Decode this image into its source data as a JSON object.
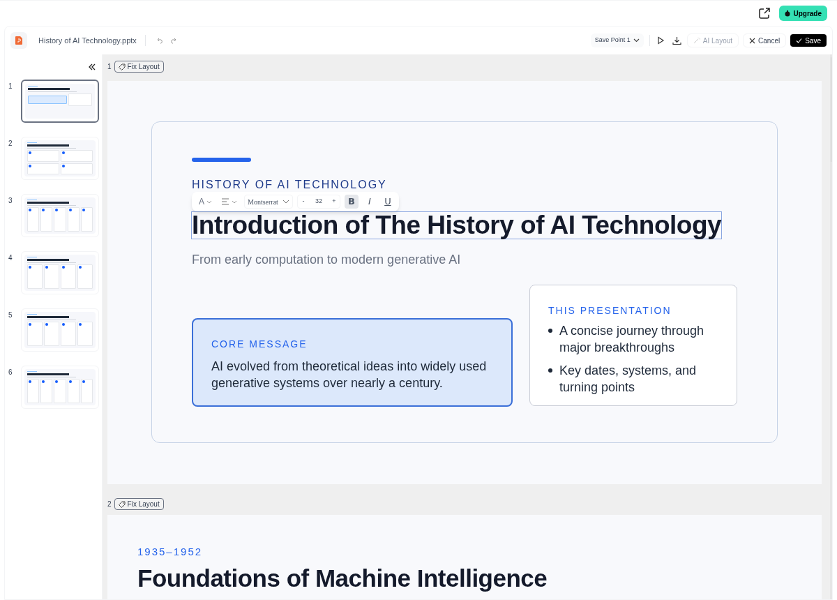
{
  "topbar": {
    "upgrade": "Upgrade"
  },
  "header": {
    "file_name": "History of AI Technology.pptx",
    "save_point": "Save Point 1",
    "ai_layout": {
      "label": "AI Layout",
      "disabled": true
    },
    "cancel": "Cancel",
    "save": "Save"
  },
  "thumbnails": [
    {
      "number": "1",
      "kind": "intro",
      "selected": true
    },
    {
      "number": "2",
      "kind": "grid",
      "selected": false
    },
    {
      "number": "3",
      "kind": "columns5",
      "selected": false
    },
    {
      "number": "4",
      "kind": "columns4",
      "selected": false
    },
    {
      "number": "5",
      "kind": "columns4",
      "selected": false
    },
    {
      "number": "6",
      "kind": "columns5",
      "selected": false
    }
  ],
  "format_toolbar": {
    "color_glyph": "A",
    "font": "Montserrat",
    "minus": "-",
    "size": "32",
    "plus": "+",
    "bold": {
      "glyph": "B",
      "on": true
    },
    "italic": {
      "glyph": "I",
      "on": false
    },
    "underline": {
      "glyph": "U",
      "on": false
    }
  },
  "slides": [
    {
      "number": "1",
      "fix_label": "Fix Layout",
      "eyebrow": "HISTORY OF AI TECHNOLOGY",
      "title": "Introduction of The History of AI Technology",
      "subtitle": "From early computation to modern generative AI",
      "core_label": "CORE MESSAGE",
      "core_text": "AI evolved from theoretical ideas into widely used generative systems over nearly a century.",
      "side_label": "THIS PRESENTATION",
      "bullets": [
        "A concise journey through major breakthroughs",
        "Key dates, systems, and turning points"
      ]
    },
    {
      "number": "2",
      "fix_label": "Fix Layout",
      "eyebrow": "1935–1952",
      "title": "Foundations of Machine Intelligence"
    }
  ]
}
